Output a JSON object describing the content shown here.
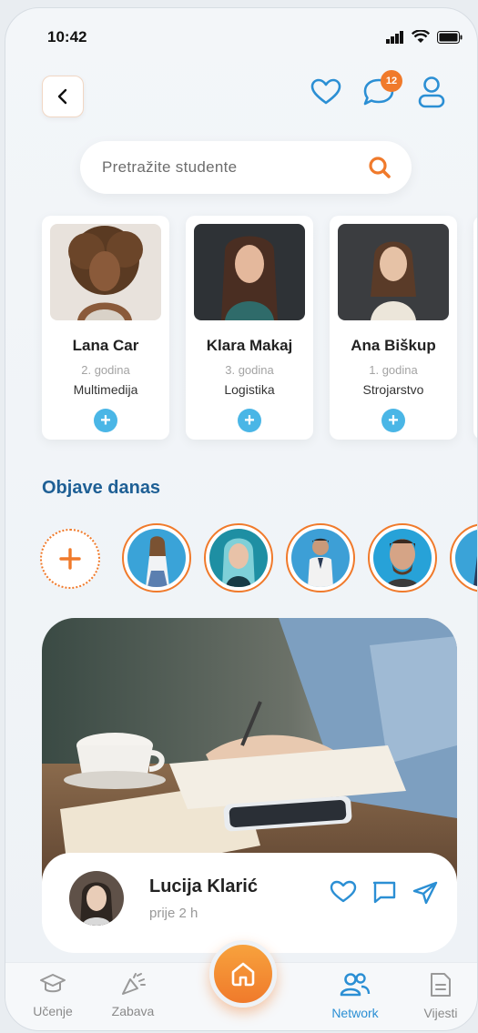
{
  "status_bar": {
    "time": "10:42"
  },
  "header": {
    "notification_count": "12"
  },
  "search": {
    "placeholder": "Pretražite studente"
  },
  "students": [
    {
      "name": "Lana Car",
      "year": "2. godina",
      "field": "Multimedija"
    },
    {
      "name": "Klara Makaj",
      "year": "3. godina",
      "field": "Logistika"
    },
    {
      "name": "Ana Biškup",
      "year": "1. godina",
      "field": "Strojarstvo"
    }
  ],
  "section": {
    "title": "Objave danas"
  },
  "post": {
    "author": "Lucija Klarić",
    "time": "prije 2 h"
  },
  "bottom_nav": {
    "items": [
      {
        "label": "Učenje",
        "icon": "graduation-cap-icon"
      },
      {
        "label": "Zabava",
        "icon": "party-popper-icon"
      },
      {
        "label": "Network",
        "icon": "people-icon",
        "active": true
      },
      {
        "label": "Vijesti",
        "icon": "news-icon"
      }
    ]
  },
  "colors": {
    "accent": "#f07a2b",
    "primary": "#2b8fd4",
    "title": "#1e5f95",
    "add_button": "#4ab6e6"
  }
}
